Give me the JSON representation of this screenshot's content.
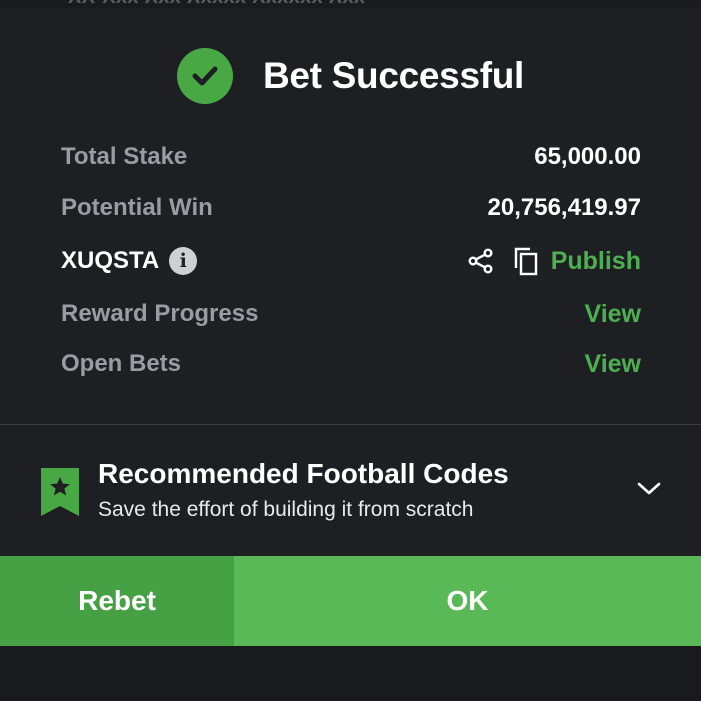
{
  "top_strip": {
    "text": "XX-Xxx Xxx Xxxxx Xxxxxx Xxx"
  },
  "header": {
    "title": "Bet Successful",
    "icon": "check-circle-icon",
    "icon_color": "#48a844"
  },
  "summary": {
    "total_stake": {
      "label": "Total Stake",
      "value": "65,000.00"
    },
    "potential_win": {
      "label": "Potential Win",
      "value": "20,756,419.97"
    },
    "booking": {
      "code": "XUQSTA",
      "info_icon": "i",
      "publish_label": "Publish"
    },
    "reward_progress": {
      "label": "Reward Progress",
      "link": "View"
    },
    "open_bets": {
      "label": "Open Bets",
      "link": "View"
    }
  },
  "recommend": {
    "title": "Recommended Football Codes",
    "subtitle": "Save the effort of building it from scratch"
  },
  "buttons": {
    "rebet": "Rebet",
    "ok": "OK"
  },
  "colors": {
    "accent_green": "#4caf50",
    "rebet_bg": "#46a044",
    "ok_bg": "#5ab957",
    "background": "#1e1f23"
  }
}
